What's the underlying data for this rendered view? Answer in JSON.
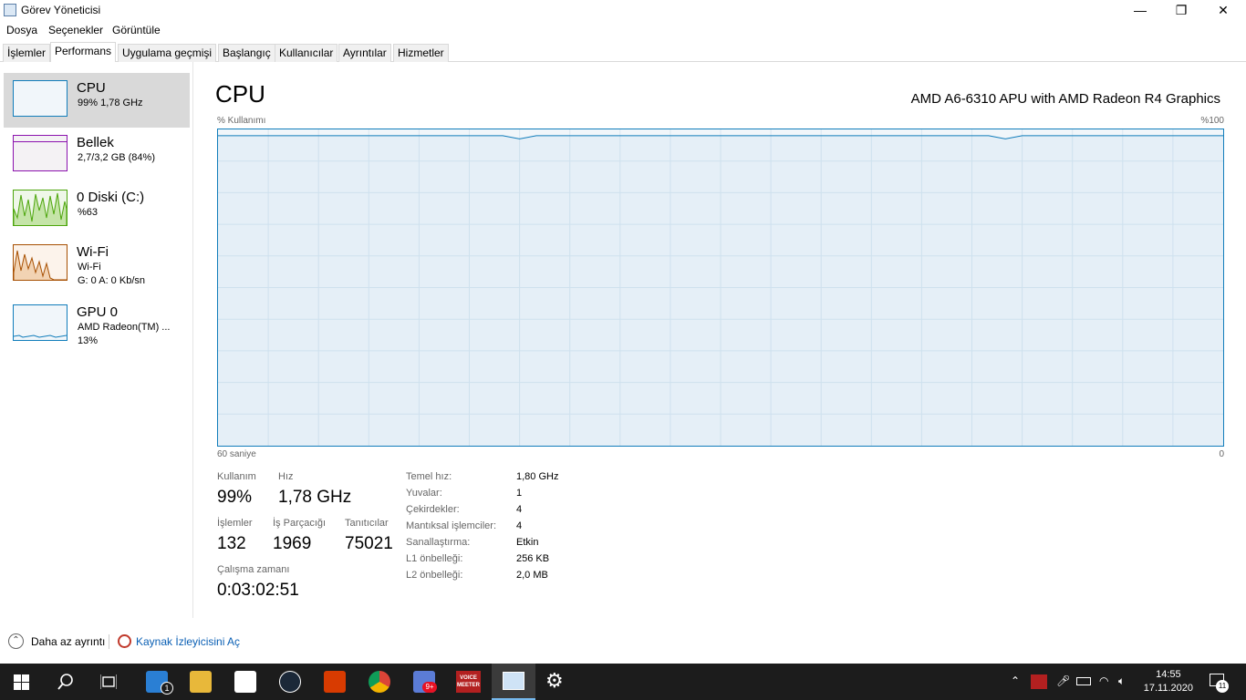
{
  "window": {
    "title": "Görev Yöneticisi",
    "minimize_glyph": "—",
    "maximize_glyph": "❐",
    "close_glyph": "✕"
  },
  "menu": [
    "Dosya",
    "Seçenekler",
    "Görüntüle"
  ],
  "tabs": [
    "İşlemler",
    "Performans",
    "Uygulama geçmişi",
    "Başlangıç",
    "Kullanıcılar",
    "Ayrıntılar",
    "Hizmetler"
  ],
  "active_tab": "Performans",
  "sidebar": {
    "items": [
      {
        "name": "CPU",
        "sub1": "99% 1,78 GHz",
        "sub2": "",
        "sub3": "",
        "color": "#117dbb"
      },
      {
        "name": "Bellek",
        "sub1": "2,7/3,2 GB (84%)",
        "sub2": "",
        "sub3": "",
        "color": "#8b12ae"
      },
      {
        "name": "0 Diski (C:)",
        "sub1": "%63",
        "sub2": "",
        "sub3": "",
        "color": "#4da60c"
      },
      {
        "name": "Wi-Fi",
        "sub1": "Wi-Fi",
        "sub2": "G: 0 A: 0 Kb/sn",
        "sub3": "",
        "color": "#a74f01"
      },
      {
        "name": "GPU 0",
        "sub1": "AMD Radeon(TM) ...",
        "sub2": "13%",
        "sub3": "",
        "color": "#117dbb"
      }
    ]
  },
  "cpu": {
    "title": "CPU",
    "model": "AMD A6-6310 APU with AMD Radeon R4 Graphics",
    "usage_label": "% Kullanımı",
    "max_label": "%100",
    "time_label": "60 saniye",
    "min_label": "0",
    "graph_color": "#117dbb",
    "usage_history": [
      98,
      98,
      98,
      98,
      98,
      98,
      98,
      98,
      98,
      98,
      98,
      98,
      98,
      98,
      98,
      98,
      98,
      98,
      97,
      98,
      98,
      98,
      98,
      98,
      98,
      98,
      98,
      98,
      98,
      98,
      98,
      98,
      98,
      98,
      98,
      98,
      98,
      98,
      98,
      98,
      98,
      98,
      98,
      98,
      98,
      98,
      98,
      97,
      98,
      98,
      98,
      98,
      98,
      98,
      98,
      98,
      98,
      98,
      98,
      98,
      98
    ],
    "stats": {
      "usage_label": "Kullanım",
      "usage_value": "99%",
      "speed_label": "Hız",
      "speed_value": "1,78 GHz",
      "processes_label": "İşlemler",
      "processes_value": "132",
      "threads_label": "İş Parçacığı",
      "threads_value": "1969",
      "handles_label": "Tanıtıcılar",
      "handles_value": "75021",
      "uptime_label": "Çalışma zamanı",
      "uptime_value": "0:03:02:51"
    },
    "details": [
      {
        "key": "Temel hız:",
        "value": "1,80 GHz"
      },
      {
        "key": "Yuvalar:",
        "value": "1"
      },
      {
        "key": "Çekirdekler:",
        "value": "4"
      },
      {
        "key": "Mantıksal işlemciler:",
        "value": "4"
      },
      {
        "key": "Sanallaştırma:",
        "value": "Etkin"
      },
      {
        "key": "L1 önbelleği:",
        "value": "256 KB"
      },
      {
        "key": "L2 önbelleği:",
        "value": "2,0 MB"
      }
    ]
  },
  "footer": {
    "less_details": "Daha az ayrıntı",
    "resource_monitor": "Kaynak İzleyicisini Aç"
  },
  "taskbar": {
    "clock_time": "14:55",
    "clock_date": "17.11.2020",
    "notification_count": "11",
    "mail_badge": "1",
    "chat_badge": "9+",
    "voicemeeter_label": "VOICE MEETER"
  }
}
